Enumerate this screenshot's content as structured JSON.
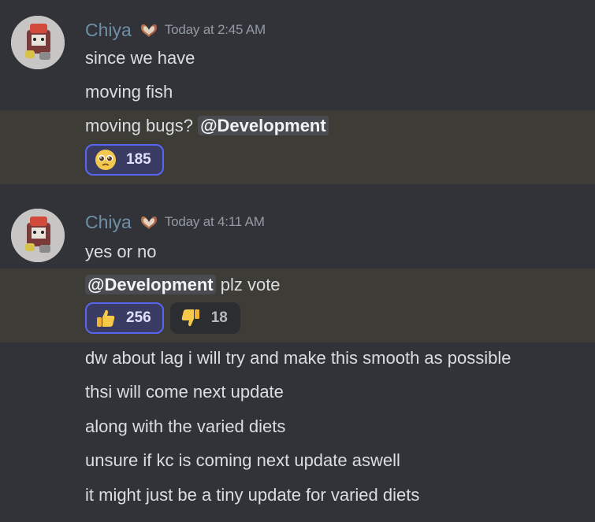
{
  "messages": [
    {
      "author": "Chiya",
      "timestamp": "Today at 2:45 AM",
      "lines": [
        "since we have",
        "moving fish"
      ],
      "highlight_line": {
        "text": "moving bugs? ",
        "mention": "@Development"
      },
      "reactions": [
        {
          "emoji": "pleading-face-icon",
          "count": "185",
          "me": true
        }
      ]
    },
    {
      "author": "Chiya",
      "timestamp": "Today at 4:11 AM",
      "lines": [
        "yes or no"
      ],
      "highlight_line": {
        "mention": "@Development",
        "text": " plz vote"
      },
      "reactions": [
        {
          "emoji": "thumbs-up-icon",
          "count": "256",
          "me": true
        },
        {
          "emoji": "thumbs-down-icon",
          "count": "18",
          "me": false
        }
      ],
      "followups": [
        "dw about lag i will try and make this smooth as possible",
        "thsi will come next update",
        "along with the varied diets",
        "unsure if kc is coming next update aswell",
        "it might just be a tiny update for varied diets"
      ]
    }
  ],
  "colors": {
    "background": "#313338",
    "highlight": "#3e3c36",
    "username": "#6f8fa6",
    "reaction_selected_border": "#5865f2"
  }
}
